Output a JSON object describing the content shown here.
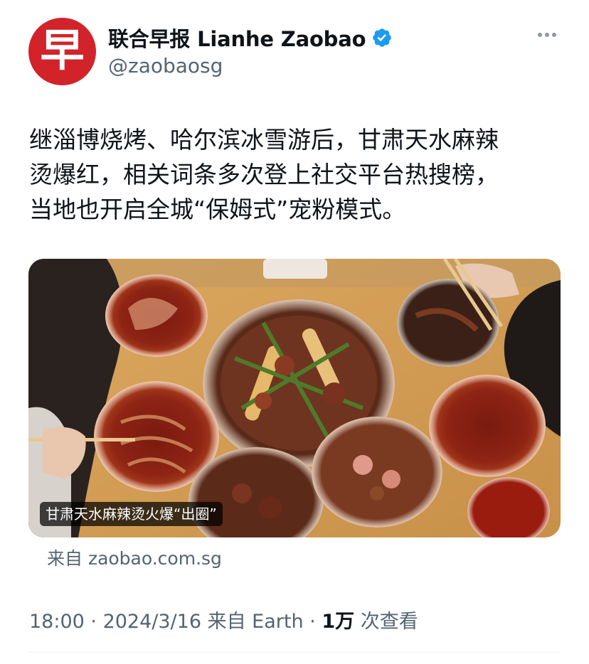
{
  "account": {
    "avatar_glyph": "早",
    "display_name": "联合早报 Lianhe Zaobao",
    "handle": "@zaobaosg",
    "brand_color": "#d2232a",
    "verified_color": "#1d9bf0"
  },
  "tweet": {
    "text": "继淄博烧烤、哈尔滨冰雪游后，甘肃天水麻辣\n烫爆红，相关词条多次登上社交平台热搜榜，\n当地也开启全城“保姆式”宠粉模式。"
  },
  "media": {
    "caption": "甘肃天水麻辣烫火爆“出圈”",
    "source": "来自 zaobao.com.sg"
  },
  "meta": {
    "time": "18:00",
    "sep1": " · ",
    "date": "2024/3/16",
    "via": " 来自 Earth",
    "sep2": " · ",
    "views_count": "1万",
    "views_label": " 次查看"
  },
  "icons": {
    "verified": "verified-badge-icon",
    "more": "more-options-icon"
  }
}
